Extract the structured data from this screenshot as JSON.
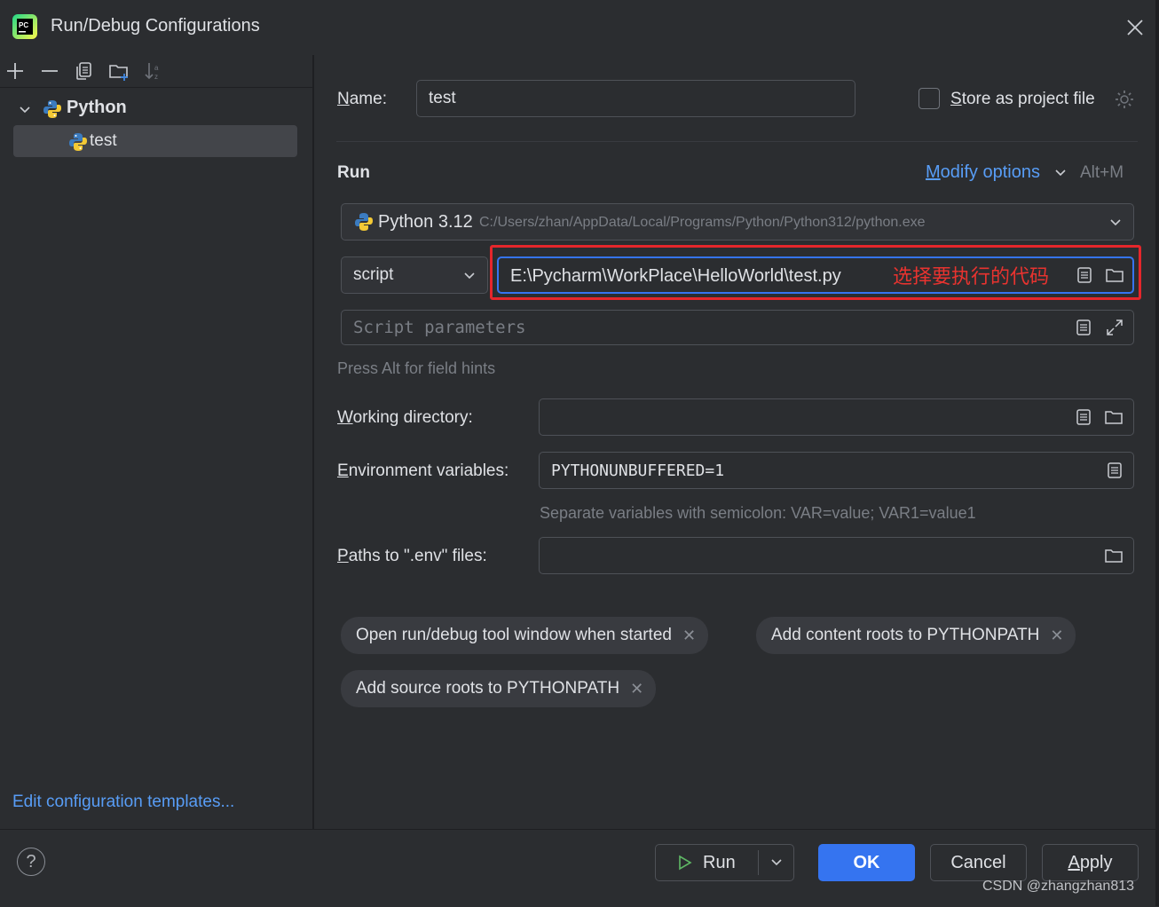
{
  "window": {
    "title": "Run/Debug Configurations"
  },
  "tree": {
    "group_label": "Python",
    "item_label": "test"
  },
  "left_footer": {
    "templates_link": "Edit configuration templates..."
  },
  "form": {
    "name_label": "Name:",
    "name_value": "test",
    "store_label": "Store as project file",
    "run_heading": "Run",
    "modify_options": "Modify options",
    "modify_shortcut": "Alt+M",
    "interpreter_name": "Python 3.12",
    "interpreter_path": "C:/Users/zhan/AppData/Local/Programs/Python/Python312/python.exe",
    "script_mode": "script",
    "script_path": "E:\\Pycharm\\WorkPlace\\HelloWorld\\test.py",
    "annotation": "选择要执行的代码",
    "params_placeholder": "Script parameters",
    "alt_hint": "Press Alt for field hints",
    "workdir_label": "Working directory:",
    "workdir_value": "",
    "env_label": "Environment variables:",
    "env_value": "PYTHONUNBUFFERED=1",
    "env_hint": "Separate variables with semicolon: VAR=value; VAR1=value1",
    "dotenv_label": "Paths to \".env\" files:",
    "dotenv_value": ""
  },
  "chips": [
    {
      "label": "Open run/debug tool window when started"
    },
    {
      "label": "Add content roots to PYTHONPATH"
    },
    {
      "label": "Add source roots to PYTHONPATH"
    }
  ],
  "buttons": {
    "run": "Run",
    "ok": "OK",
    "cancel": "Cancel",
    "apply": "Apply",
    "help": "?"
  },
  "watermark": "CSDN @zhangzhan813",
  "colors": {
    "accent": "#3574f0",
    "link": "#589df6",
    "annotation_red": "#e5262b",
    "background": "#2b2d30"
  },
  "icons": [
    "pycharm-logo-icon",
    "close-icon",
    "add-icon",
    "remove-icon",
    "copy-icon",
    "folder-add-icon",
    "sort-icon",
    "chevron-down-icon",
    "python-icon",
    "gear-icon",
    "list-icon",
    "folder-icon",
    "expand-icon",
    "play-icon",
    "help-icon"
  ]
}
